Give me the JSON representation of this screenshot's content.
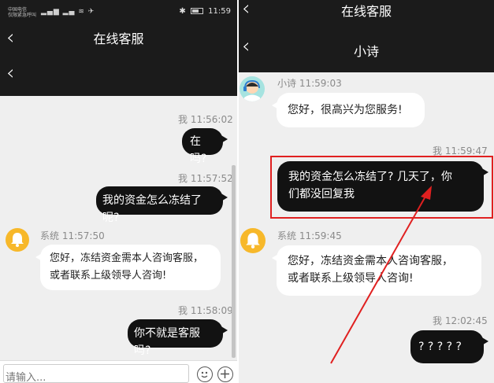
{
  "left": {
    "status": {
      "carrier_line1": "中国电信",
      "carrier_line2": "仅限紧急呼叫",
      "time": "11:59"
    },
    "header_title": "在线客服",
    "messages": [
      {
        "side": "out",
        "sender": "我",
        "time": "11:56:02",
        "text": "在吗?"
      },
      {
        "side": "out",
        "sender": "我",
        "time": "11:57:52",
        "text": "我的资金怎么冻结了呢?"
      },
      {
        "side": "in",
        "sender": "系统",
        "time": "11:57:50",
        "text_line1": "您好，冻结资金需本人咨询客服，",
        "text_line2": "或者联系上级领导人咨询!"
      },
      {
        "side": "out",
        "sender": "我",
        "time": "11:58:09",
        "text": "你不就是客服吗?"
      }
    ],
    "input_placeholder": "请输入..."
  },
  "right": {
    "header_title": "在线客服",
    "agent_title": "小诗",
    "messages": [
      {
        "side": "in",
        "sender": "小诗",
        "time": "11:59:03",
        "text": "您好，很高兴为您服务!"
      },
      {
        "side": "out",
        "sender": "我",
        "time": "11:59:47",
        "text_line1": "我的资金怎么冻结了? 几天了，你",
        "text_line2": "们都没回复我"
      },
      {
        "side": "in",
        "sender": "系统",
        "time": "11:59:45",
        "text_line1": "您好，冻结资金需本人咨询客服，",
        "text_line2": "或者联系上级领导人咨询!"
      },
      {
        "side": "out",
        "sender": "我",
        "time": "12:02:45",
        "text": "? ? ? ? ?"
      }
    ]
  },
  "colors": {
    "header": "#1b1b1b",
    "bubble_out": "#121212",
    "bubble_in": "#ffffff",
    "chat_bg": "#efefef",
    "system_icon": "#f7b82a",
    "annotation": "#e02020"
  },
  "icons": [
    "back-arrow-icon",
    "bell-icon",
    "customer-service-avatar-icon",
    "emoji-icon",
    "plus-icon",
    "signal-icon",
    "wifi-icon",
    "bluetooth-icon",
    "battery-icon"
  ]
}
